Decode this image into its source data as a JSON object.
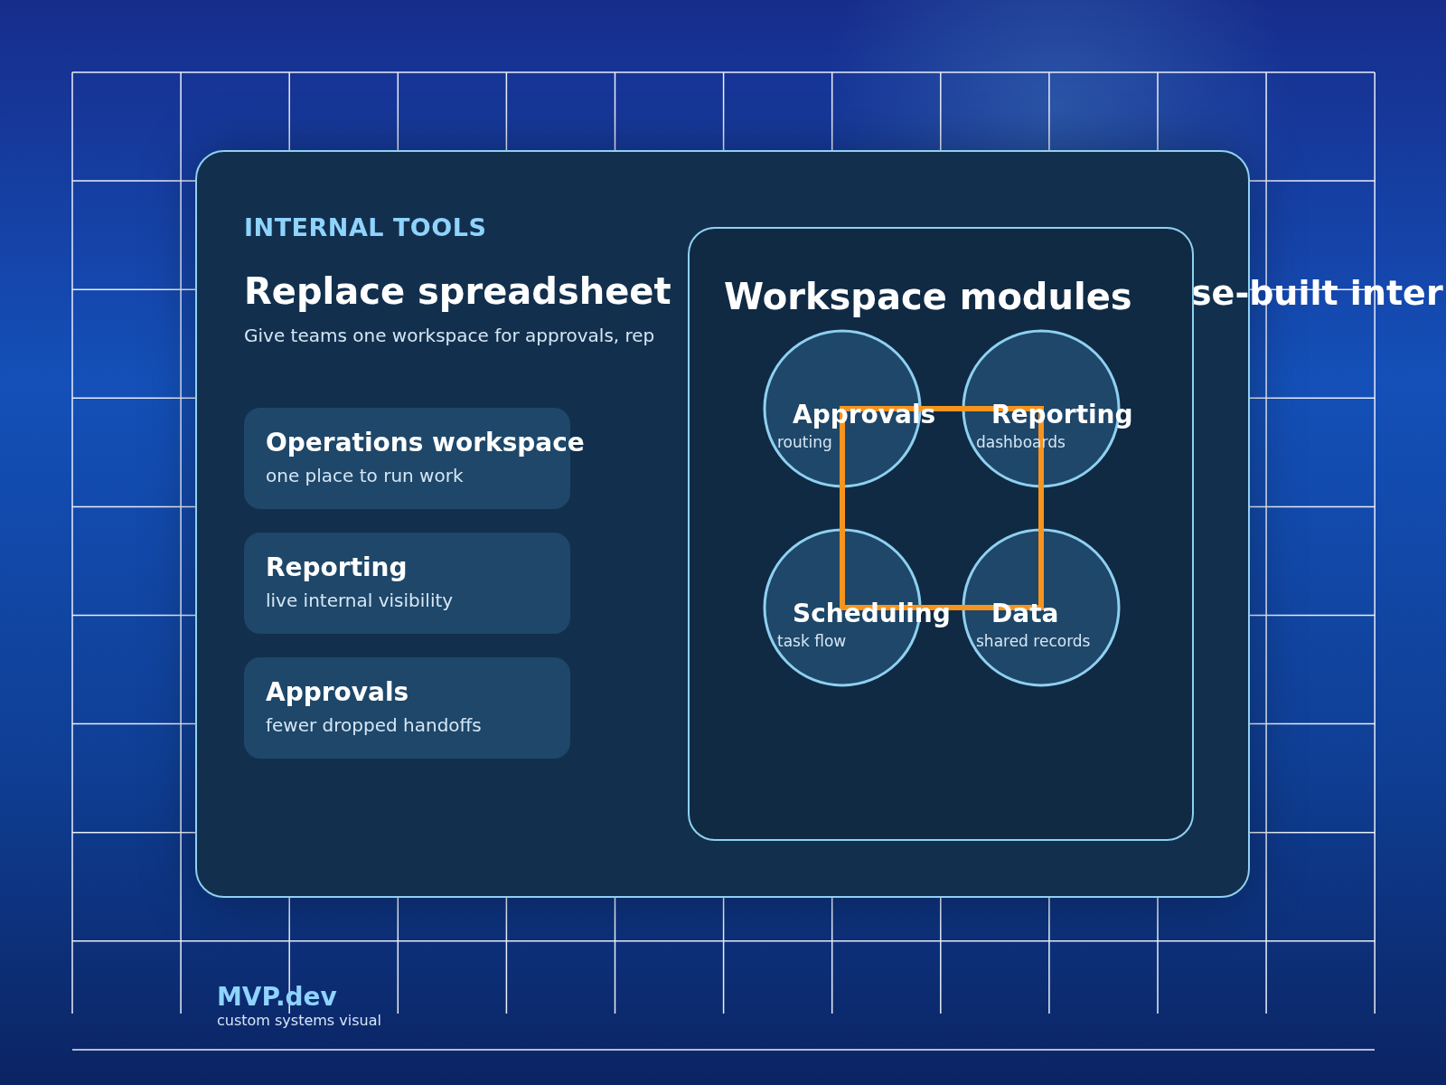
{
  "eyebrow": "INTERNAL TOOLS",
  "heading": {
    "left": "Replace spreadsheet",
    "right": "se-built inter"
  },
  "subtitle": "Give teams one workspace for approvals, rep",
  "features": [
    {
      "title": "Operations workspace",
      "subtitle": "one place to run work"
    },
    {
      "title": "Reporting",
      "subtitle": "live internal visibility"
    },
    {
      "title": "Approvals",
      "subtitle": "fewer dropped handoffs"
    }
  ],
  "panel": {
    "title": "Workspace modules",
    "modules": [
      {
        "name": "Approvals",
        "detail": "routing"
      },
      {
        "name": "Reporting",
        "detail": "dashboards"
      },
      {
        "name": "Scheduling",
        "detail": "task flow"
      },
      {
        "name": "Data",
        "detail": "shared records"
      }
    ]
  },
  "brand": {
    "name": "MVP.dev",
    "tagline": "custom systems visual"
  }
}
